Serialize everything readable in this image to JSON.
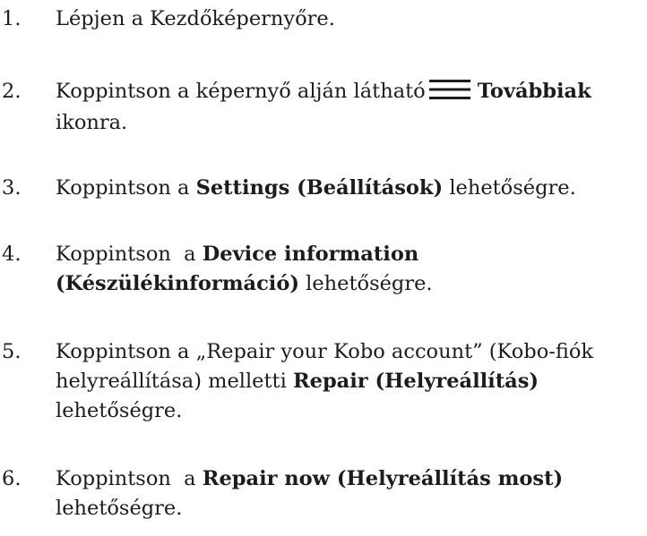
{
  "steps": [
    {
      "number": "1.",
      "lines": [
        {
          "parts": [
            {
              "text": "Lépjen a Kezdőképernyőre."
            }
          ]
        }
      ]
    },
    {
      "number": "2.",
      "lines": [
        {
          "parts": [
            {
              "text": "Koppintson a képernyő alján látható"
            },
            {
              "icon": "hamburger-menu-icon"
            },
            {
              "text": "Továbbiak",
              "bold": true
            }
          ]
        },
        {
          "parts": [
            {
              "text": "ikonra."
            }
          ]
        }
      ]
    },
    {
      "number": "3.",
      "lines": [
        {
          "parts": [
            {
              "text": "Koppintson a "
            },
            {
              "text": "Settings (Beállítások)",
              "bold": true
            },
            {
              "text": " lehetőségre."
            }
          ]
        }
      ]
    },
    {
      "number": "4.",
      "lines": [
        {
          "parts": [
            {
              "text": "Koppintson  a "
            },
            {
              "text": "Device information",
              "bold": true
            }
          ]
        },
        {
          "parts": [
            {
              "text": "(Készülékinformáció)",
              "bold": true
            },
            {
              "text": " lehetőségre."
            }
          ]
        }
      ]
    },
    {
      "number": "5.",
      "lines": [
        {
          "parts": [
            {
              "text": "Koppintson a „Repair your Kobo account” (Kobo-fiók"
            }
          ]
        },
        {
          "parts": [
            {
              "text": "helyreállítása) melletti "
            },
            {
              "text": "Repair (Helyreállítás)",
              "bold": true
            }
          ]
        },
        {
          "parts": [
            {
              "text": "lehetőségre."
            }
          ]
        }
      ]
    },
    {
      "number": "6.",
      "lines": [
        {
          "parts": [
            {
              "text": "Koppintson  a "
            },
            {
              "text": "Repair now (Helyreállítás most)",
              "bold": true
            }
          ]
        },
        {
          "parts": [
            {
              "text": "lehetőségre."
            }
          ]
        }
      ]
    }
  ]
}
